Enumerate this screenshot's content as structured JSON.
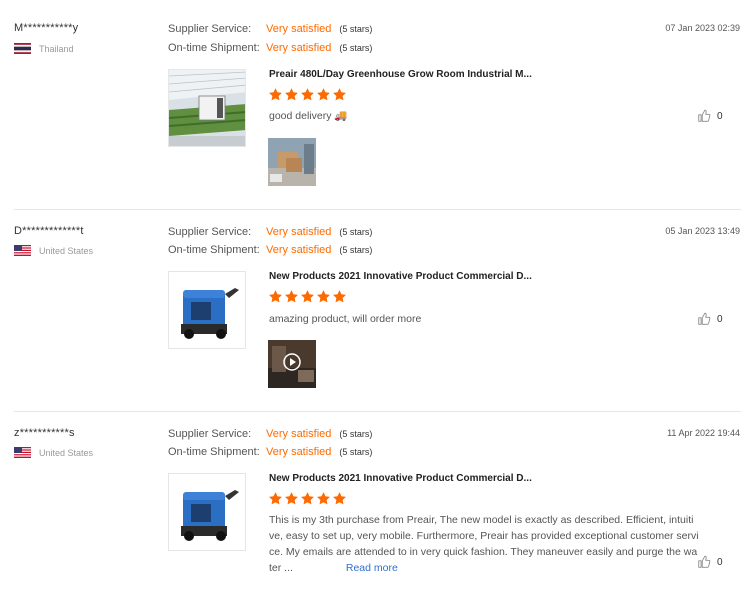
{
  "reviews": [
    {
      "user": "M***********y",
      "country": "Thailand",
      "flag": "thailand-flag",
      "supplier_label": "Supplier Service:",
      "supplier_value": "Very satisfied",
      "supplier_stars": "(5 stars)",
      "shipment_label": "On-time Shipment:",
      "shipment_value": "Very satisfied",
      "shipment_stars": "(5 stars)",
      "date": "07 Jan 2023 02:39",
      "product_title": "Preair 480L/Day Greenhouse Grow Room Industrial M...",
      "rating": 5,
      "comment": "good delivery",
      "comment_emoji": "🚚",
      "likes": "0"
    },
    {
      "user": "D*************t",
      "country": "United States",
      "flag": "us-flag",
      "supplier_label": "Supplier Service:",
      "supplier_value": "Very satisfied",
      "supplier_stars": "(5 stars)",
      "shipment_label": "On-time Shipment:",
      "shipment_value": "Very satisfied",
      "shipment_stars": "(5 stars)",
      "date": "05 Jan 2023 13:49",
      "product_title": "New Products 2021 Innovative Product Commercial D...",
      "rating": 5,
      "comment": "amazing product,  will order more",
      "likes": "0"
    },
    {
      "user": "z***********s",
      "country": "United States",
      "flag": "us-flag",
      "supplier_label": "Supplier Service:",
      "supplier_value": "Very satisfied",
      "supplier_stars": "(5 stars)",
      "shipment_label": "On-time Shipment:",
      "shipment_value": "Very satisfied",
      "shipment_stars": "(5 stars)",
      "date": "11 Apr 2022 19:44",
      "product_title": "New Products 2021 Innovative Product Commercial D...",
      "rating": 5,
      "comment_lines": [
        "This is my 3th purchase from Preair, The new model is exactly as described. Efficient, intuiti",
        "ve, easy to set up, very mobile. Furthermore, Preair has provided exceptional customer servi",
        "ce. My emails are attended to in very quick fashion. They maneuver easily and purge the wa",
        "ter ..."
      ],
      "read_more": "Read more",
      "likes": "0"
    }
  ],
  "colors": {
    "accent": "#ff6a00",
    "link": "#2f6fd0",
    "divider": "#e6e6e6"
  }
}
